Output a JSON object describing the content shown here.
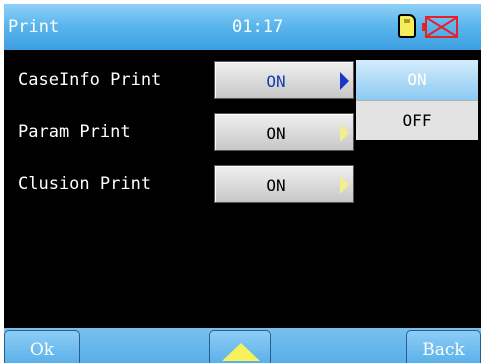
{
  "header": {
    "title": "Print",
    "time": "01:17",
    "sd_icon": "sd-card-icon",
    "status_icon": "disconnected-x-icon",
    "status_color": "#e8202a"
  },
  "rows": [
    {
      "label": "CaseInfo Print",
      "value": "ON",
      "active": true
    },
    {
      "label": "Param Print",
      "value": "ON",
      "active": false
    },
    {
      "label": "Clusion Print",
      "value": "ON",
      "active": false
    }
  ],
  "dropdown": {
    "options": [
      "ON",
      "OFF"
    ],
    "selected": "ON"
  },
  "footer": {
    "ok_label": "Ok",
    "up_icon": "up-arrow-icon",
    "back_label": "Back"
  },
  "colors": {
    "title_bar": "#58b4ec",
    "background": "#000000",
    "active_value": "#1a3ca8",
    "arrow_active": "#1637c8",
    "arrow_inactive": "#f2f08c"
  }
}
